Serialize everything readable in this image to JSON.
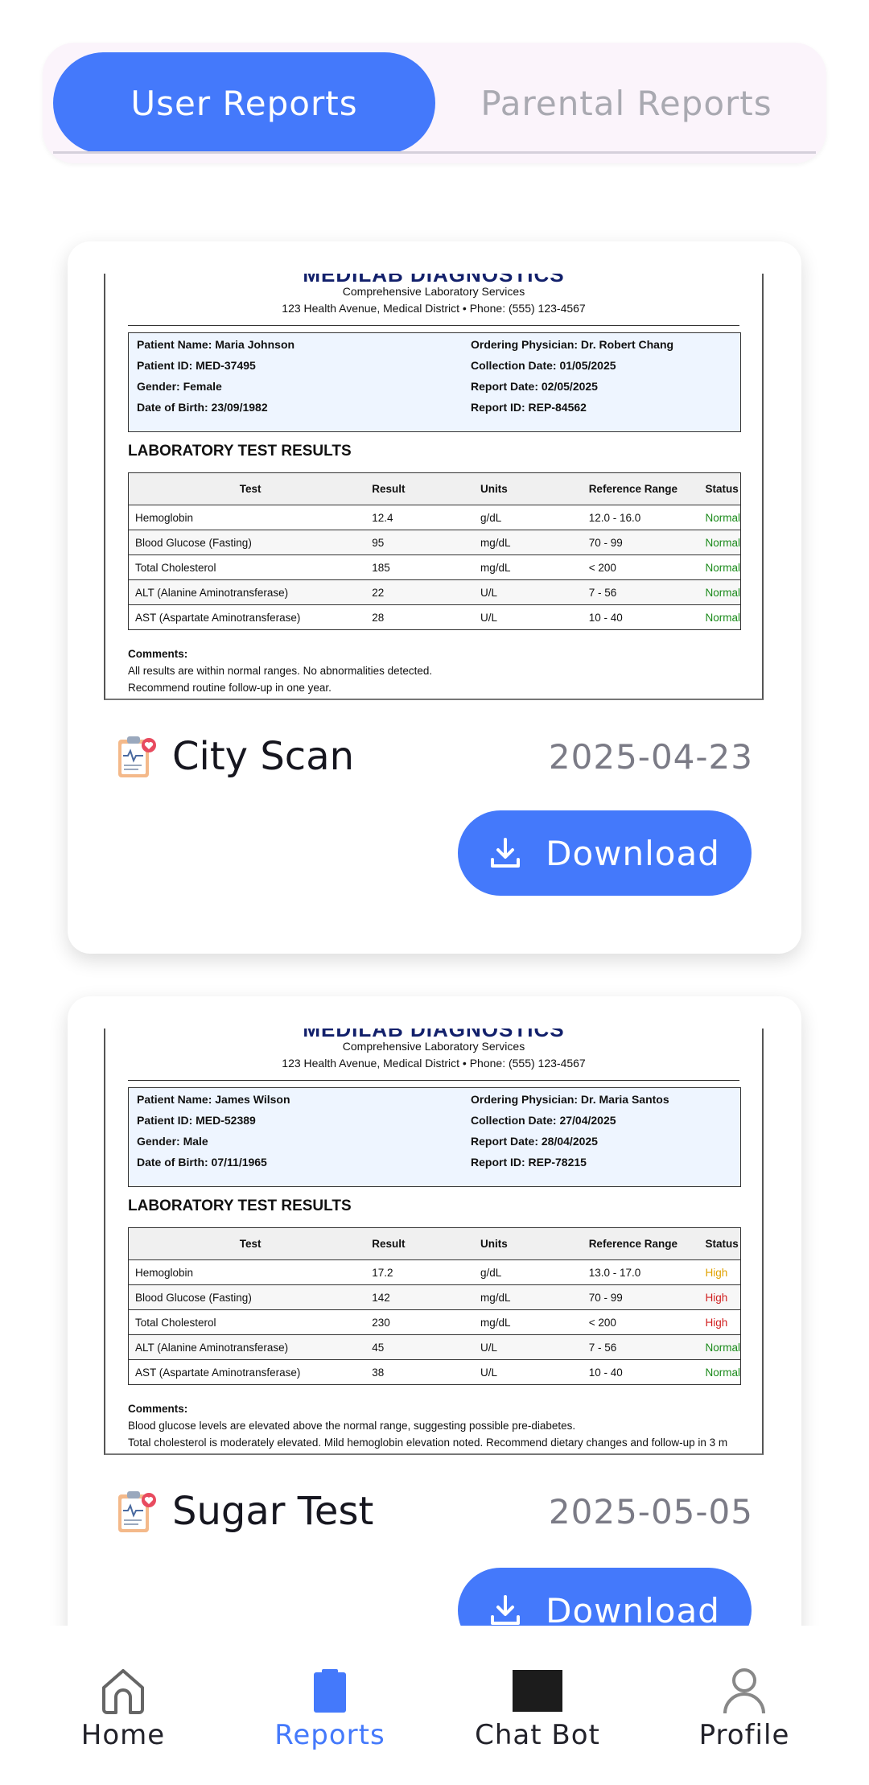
{
  "tabs": {
    "user_reports": "User Reports",
    "parental_reports": "Parental Reports"
  },
  "reports": [
    {
      "doc": {
        "brand": "MEDILAB DIAGNOSTICS",
        "subtitle": "Comprehensive Laboratory Services",
        "address": "123 Health Avenue, Medical District • Phone: (555) 123-4567",
        "patient_name": "Patient Name: Maria Johnson",
        "patient_id": "Patient ID: MED-37495",
        "gender": "Gender: Female",
        "dob": "Date of Birth: 23/09/1982",
        "physician": "Ordering Physician: Dr. Robert Chang",
        "collection_date": "Collection Date: 01/05/2025",
        "report_date": "Report Date: 02/05/2025",
        "report_id": "Report ID: REP-84562",
        "results_title": "LABORATORY TEST RESULTS",
        "headers": [
          "Test",
          "Result",
          "Units",
          "Reference Range",
          "Status"
        ],
        "rows": [
          [
            "Hemoglobin",
            "12.4",
            "g/dL",
            "12.0 - 16.0",
            "Normal"
          ],
          [
            "Blood Glucose (Fasting)",
            "95",
            "mg/dL",
            "70 - 99",
            "Normal"
          ],
          [
            "Total Cholesterol",
            "185",
            "mg/dL",
            "< 200",
            "Normal"
          ],
          [
            "ALT (Alanine Aminotransferase)",
            "22",
            "U/L",
            "7 - 56",
            "Normal"
          ],
          [
            "AST (Aspartate Aminotransferase)",
            "28",
            "U/L",
            "10 - 40",
            "Normal"
          ]
        ],
        "status_colors": [
          "#1a8a1a",
          "#1a8a1a",
          "#1a8a1a",
          "#1a8a1a",
          "#1a8a1a"
        ],
        "comments_label": "Comments:",
        "comment_1": "All results are within normal ranges. No abnormalities detected.",
        "comment_2": "Recommend routine follow-up in one year."
      },
      "name": "City Scan",
      "date": "2025-04-23",
      "download": "Download"
    },
    {
      "doc": {
        "brand": "MEDILAB DIAGNOSTICS",
        "subtitle": "Comprehensive Laboratory Services",
        "address": "123 Health Avenue, Medical District • Phone: (555) 123-4567",
        "patient_name": "Patient Name: James Wilson",
        "patient_id": "Patient ID: MED-52389",
        "gender": "Gender: Male",
        "dob": "Date of Birth: 07/11/1965",
        "physician": "Ordering Physician: Dr. Maria Santos",
        "collection_date": "Collection Date: 27/04/2025",
        "report_date": "Report Date: 28/04/2025",
        "report_id": "Report ID: REP-78215",
        "results_title": "LABORATORY TEST RESULTS",
        "headers": [
          "Test",
          "Result",
          "Units",
          "Reference Range",
          "Status"
        ],
        "rows": [
          [
            "Hemoglobin",
            "17.2",
            "g/dL",
            "13.0 - 17.0",
            "High"
          ],
          [
            "Blood Glucose (Fasting)",
            "142",
            "mg/dL",
            "70 - 99",
            "High"
          ],
          [
            "Total Cholesterol",
            "230",
            "mg/dL",
            "< 200",
            "High"
          ],
          [
            "ALT (Alanine Aminotransferase)",
            "45",
            "U/L",
            "7 - 56",
            "Normal"
          ],
          [
            "AST (Aspartate Aminotransferase)",
            "38",
            "U/L",
            "10 - 40",
            "Normal"
          ]
        ],
        "status_colors": [
          "#e0a100",
          "#d01e1e",
          "#d01e1e",
          "#1a8a1a",
          "#1a8a1a"
        ],
        "comments_label": "Comments:",
        "comment_1": "Blood glucose levels are elevated above the normal range, suggesting possible pre-diabetes.",
        "comment_2": "Total cholesterol is moderately elevated. Mild hemoglobin elevation noted. Recommend dietary changes and follow-up in 3 m"
      },
      "name": "Sugar Test",
      "date": "2025-05-05",
      "download": "Download"
    }
  ],
  "nav": {
    "home": "Home",
    "reports": "Reports",
    "chatbot": "Chat Bot",
    "profile": "Profile"
  },
  "colors": {
    "accent": "#4479fb",
    "active_tab_text": "#ffffff",
    "inactive_tab_text": "#a9a9b1"
  },
  "icons": {
    "report_card": "clipboard-medical-icon",
    "download": "download-icon",
    "home": "home-icon",
    "reports": "reports-icon",
    "chatbot": "chatbot-icon",
    "profile": "profile-icon"
  }
}
